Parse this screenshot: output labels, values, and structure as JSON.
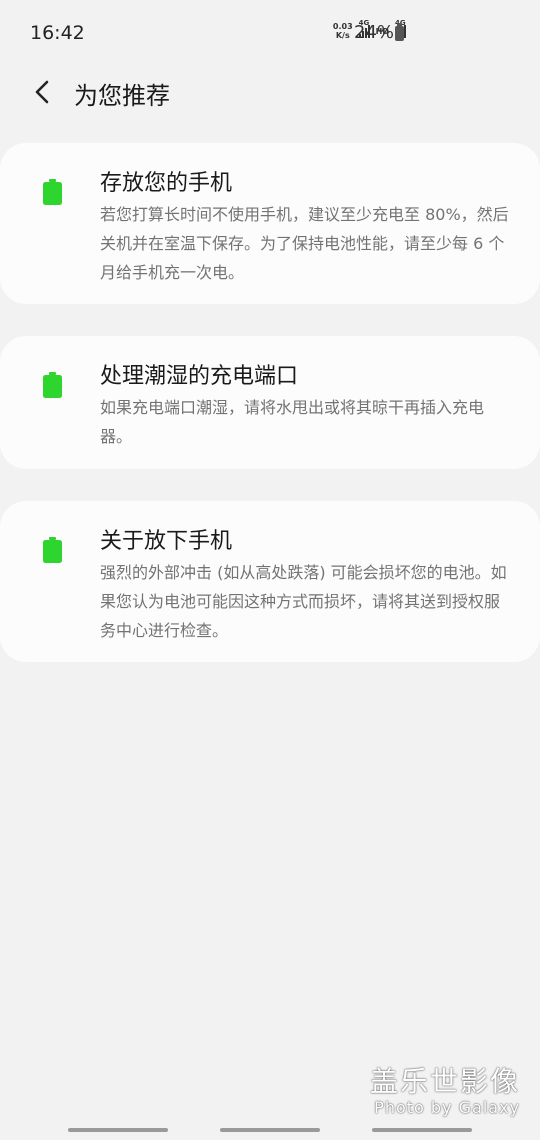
{
  "status_bar": {
    "time": "16:42",
    "net_speed_value": "0.03",
    "net_speed_unit": "K/s",
    "sim1_tag": "4G",
    "hd_tag": "HD",
    "sim2_tag": "4G",
    "battery_percent": "24%"
  },
  "header": {
    "title": "为您推荐"
  },
  "cards": [
    {
      "icon": "battery-icon",
      "title": "存放您的手机",
      "description": "若您打算长时间不使用手机，建议至少充电至 80%，然后关机并在室温下保存。为了保持电池性能，请至少每 6 个月给手机充一次电。"
    },
    {
      "icon": "battery-icon",
      "title": "处理潮湿的充电端口",
      "description": "如果充电端口潮湿，请将水甩出或将其晾干再插入充电器。"
    },
    {
      "icon": "battery-icon",
      "title": "关于放下手机",
      "description": "强烈的外部冲击 (如从高处跌落) 可能会损坏您的电池。如果您认为电池可能因这种方式而损坏，请将其送到授权服务中心进行检查。"
    }
  ],
  "watermark": {
    "cn": "盖乐世影像",
    "en": "Photo by Galaxy"
  },
  "colors": {
    "background": "#f2f2f2",
    "card": "#fcfcfc",
    "battery_green": "#2ed52e",
    "secondary_text": "#737373"
  }
}
